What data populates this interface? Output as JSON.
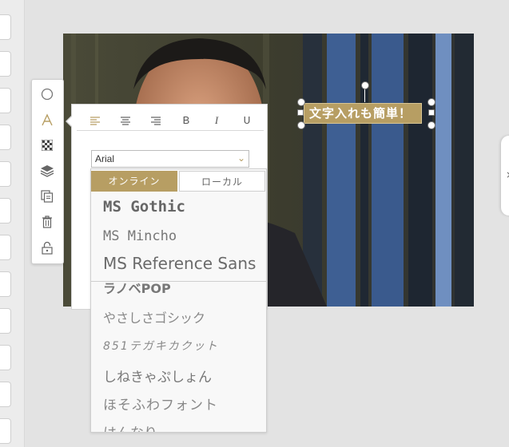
{
  "canvas": {
    "text_element": {
      "text": "文字入れも簡単！",
      "bg_color": "#b79e63"
    }
  },
  "toolbar": {
    "tools": [
      {
        "icon": "circle-shape-icon"
      },
      {
        "icon": "text-tool-icon"
      },
      {
        "icon": "pattern-fill-icon"
      },
      {
        "icon": "layers-icon"
      },
      {
        "icon": "duplicate-icon"
      },
      {
        "icon": "trash-icon"
      },
      {
        "icon": "lock-icon"
      }
    ],
    "active_color": "#b79e63"
  },
  "format_panel": {
    "buttons": [
      {
        "icon": "align-left-icon"
      },
      {
        "icon": "align-center-icon"
      },
      {
        "icon": "align-right-icon"
      },
      {
        "label": "B"
      },
      {
        "label": "I"
      },
      {
        "label": "U"
      }
    ],
    "font_select": {
      "value": "Arial"
    }
  },
  "font_dropdown": {
    "tabs": [
      {
        "label": "オンライン",
        "active": true
      },
      {
        "label": "ローカル",
        "active": false
      }
    ],
    "fonts": [
      "MS Gothic",
      "MS Mincho",
      "MS Reference Sans",
      "ラノベPOP",
      "やさしさゴシック",
      "851テガキカクット",
      "しねきゃぷしょん",
      "ほそふわフォント",
      "はんなり"
    ]
  },
  "right_tab": {
    "label": "×"
  }
}
